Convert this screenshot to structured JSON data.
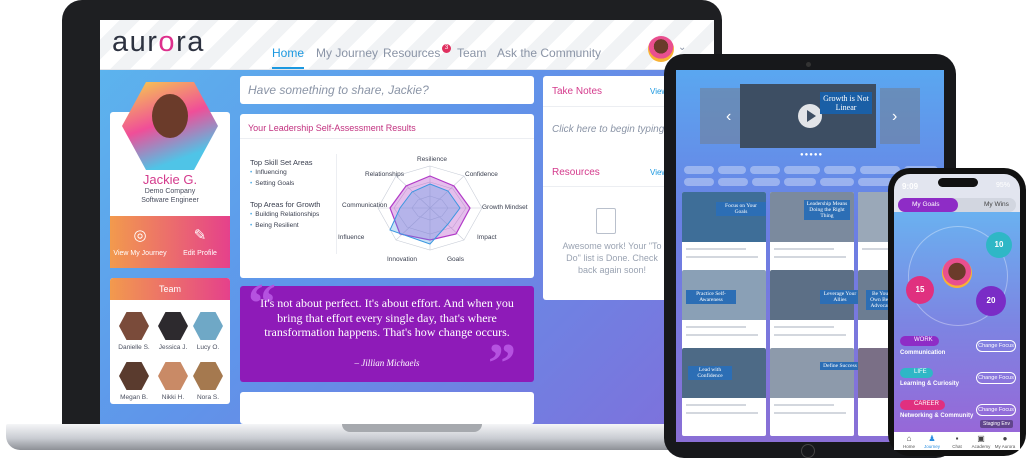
{
  "app": {
    "logo": "aurora"
  },
  "nav": {
    "items": [
      "Home",
      "My Journey",
      "Resources",
      "Team",
      "Ask the Community"
    ],
    "badge": "3"
  },
  "profile": {
    "name": "Jackie G.",
    "company": "Demo Company",
    "title": "Software Engineer",
    "view_journey": "View My Journey",
    "edit_profile": "Edit Profile"
  },
  "team": {
    "title": "Team",
    "members": [
      "Danielle S.",
      "Jessica J.",
      "Lucy O.",
      "Megan B.",
      "Nikki H.",
      "Nora S."
    ]
  },
  "share": {
    "placeholder": "Have something to share, Jackie?"
  },
  "assessment": {
    "title": "Your Leadership Self-Assessment Results",
    "top_skills_label": "Top Skill Set Areas",
    "top_skills": [
      "Influencing",
      "Setting Goals"
    ],
    "growth_label": "Top Areas for Growth",
    "growth": [
      "Building Relationships",
      "Being Resilient"
    ],
    "axes": [
      "Resilience",
      "Confidence",
      "Growth Mindset",
      "Impact",
      "Goals",
      "Innovation",
      "Influence",
      "Communication",
      "Relationships"
    ]
  },
  "quote": {
    "text": "It's not about perfect. It's about effort. And when you bring that effort every single day, that's where transformation happens. That's how change occurs.",
    "author": "– Jillian Michaels"
  },
  "notes": {
    "title": "Take Notes",
    "view": "View",
    "placeholder": "Click here to begin typing..."
  },
  "resources": {
    "title": "Resources",
    "view": "View",
    "message": "Awesome work! Your \"To Do\" list is Done. Check back again soon!"
  },
  "tablet": {
    "video_caption": "Growth is Not Linear",
    "cards": [
      "Focus on Your Goals",
      "Leadership Means Doing the Right Thing",
      "",
      "Practice Self-Awareness",
      "Leverage Your Allies",
      "Be Your Own Best Advocate",
      "Lead with Confidence",
      "Define Success",
      ""
    ]
  },
  "phone": {
    "time": "9:09",
    "battery": "95%",
    "tab_goals": "My Goals",
    "tab_wins": "My Wins",
    "bubbles": [
      "10",
      "15",
      "20"
    ],
    "work": "WORK",
    "work_cat": "Communication",
    "life": "LIFE",
    "life_cat": "Learning & Curiosity",
    "career": "CAREER",
    "career_cat": "Networking & Community",
    "change_focus": "Change Focus",
    "staging": "Staging Env",
    "nav": [
      "Home",
      "Journey",
      "Chat",
      "Academy",
      "My Aurora"
    ]
  }
}
